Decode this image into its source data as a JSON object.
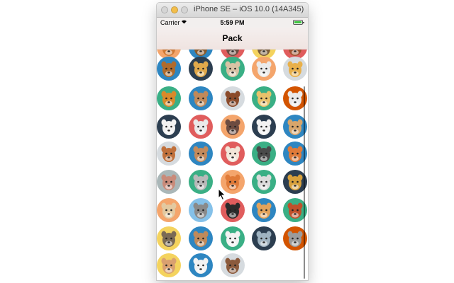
{
  "window": {
    "title": "iPhone SE – iOS 10.0 (14A345)"
  },
  "status_bar": {
    "carrier": "Carrier",
    "time": "5:59 PM"
  },
  "nav": {
    "title": "Pack"
  },
  "colors": {
    "nav_background": "#f2e8e6",
    "scroll_indicator": "#6f6f6f"
  },
  "animals": [
    {
      "name": "partial-top-1",
      "bg": "#f4a56c",
      "face": "#d17a35",
      "row": 0,
      "col": 0
    },
    {
      "name": "partial-top-2",
      "bg": "#2e86c1",
      "face": "#8a5a2b",
      "row": 0,
      "col": 1
    },
    {
      "name": "partial-top-3",
      "bg": "#e05d5d",
      "face": "#6d4c41",
      "row": 0,
      "col": 2
    },
    {
      "name": "partial-top-4",
      "bg": "#f4d35e",
      "face": "#7b5e3b",
      "row": 0,
      "col": 3
    },
    {
      "name": "partial-top-5",
      "bg": "#e05d5d",
      "face": "#a0522d",
      "row": 0,
      "col": 4
    },
    {
      "name": "deer",
      "bg": "#2e86c1",
      "face": "#b06b2c",
      "row": 1,
      "col": 0
    },
    {
      "name": "cheetah",
      "bg": "#2c3e50",
      "face": "#e1a94b",
      "row": 1,
      "col": 1
    },
    {
      "name": "goat",
      "bg": "#3aaf85",
      "face": "#d8c3a5",
      "row": 1,
      "col": 2
    },
    {
      "name": "zebra",
      "bg": "#f4a56c",
      "face": "#eaeaea",
      "row": 1,
      "col": 3
    },
    {
      "name": "giraffe",
      "bg": "#d6dbdf",
      "face": "#e8b04b",
      "row": 1,
      "col": 4
    },
    {
      "name": "lion",
      "bg": "#3aaf85",
      "face": "#d98a2b",
      "row": 2,
      "col": 0
    },
    {
      "name": "bull",
      "bg": "#2e86c1",
      "face": "#c0895a",
      "row": 2,
      "col": 1
    },
    {
      "name": "horse",
      "bg": "#d6dbdf",
      "face": "#8b4b2b",
      "row": 2,
      "col": 2
    },
    {
      "name": "jaguar",
      "bg": "#3aaf85",
      "face": "#e8c26b",
      "row": 2,
      "col": 3
    },
    {
      "name": "ibex",
      "bg": "#d35400",
      "face": "#eaeaea",
      "row": 2,
      "col": 4
    },
    {
      "name": "polar-bear",
      "bg": "#2c3e50",
      "face": "#f2f2f2",
      "row": 3,
      "col": 0
    },
    {
      "name": "antelope",
      "bg": "#e05d5d",
      "face": "#eaeaea",
      "row": 3,
      "col": 1
    },
    {
      "name": "bear",
      "bg": "#f4a56c",
      "face": "#6d4c41",
      "row": 3,
      "col": 2
    },
    {
      "name": "dog",
      "bg": "#2c3e50",
      "face": "#f2f2f2",
      "row": 3,
      "col": 3
    },
    {
      "name": "lynx",
      "bg": "#2e86c1",
      "face": "#d7a56b",
      "row": 3,
      "col": 4
    },
    {
      "name": "monkey",
      "bg": "#d6dbdf",
      "face": "#c0703b",
      "row": 4,
      "col": 0
    },
    {
      "name": "kangaroo",
      "bg": "#2e86c1",
      "face": "#c48a5b",
      "row": 4,
      "col": 1
    },
    {
      "name": "spaniel",
      "bg": "#e05d5d",
      "face": "#f2e6d9",
      "row": 4,
      "col": 2
    },
    {
      "name": "ram",
      "bg": "#3aaf85",
      "face": "#4a4a4a",
      "row": 4,
      "col": 3
    },
    {
      "name": "fox",
      "bg": "#2e86c1",
      "face": "#e07b39",
      "row": 4,
      "col": 4
    },
    {
      "name": "hippo",
      "bg": "#aab7b8",
      "face": "#c98b7a",
      "row": 5,
      "col": 0
    },
    {
      "name": "koala",
      "bg": "#3aaf85",
      "face": "#b9b9b9",
      "row": 5,
      "col": 1
    },
    {
      "name": "orangutan",
      "bg": "#f4a56c",
      "face": "#e07b39",
      "row": 5,
      "col": 2
    },
    {
      "name": "lemur",
      "bg": "#3aaf85",
      "face": "#dcdcdc",
      "row": 5,
      "col": 3
    },
    {
      "name": "lion-cub",
      "bg": "#2c3e50",
      "face": "#d9a13b",
      "row": 5,
      "col": 4
    },
    {
      "name": "pug",
      "bg": "#f4a56c",
      "face": "#e3c9a0",
      "row": 6,
      "col": 0
    },
    {
      "name": "wolf",
      "bg": "#85c1e9",
      "face": "#8a8a8a",
      "row": 6,
      "col": 1
    },
    {
      "name": "penguin",
      "bg": "#e05d5d",
      "face": "#2b2b2b",
      "row": 6,
      "col": 2
    },
    {
      "name": "retriever",
      "bg": "#2e86c1",
      "face": "#e3a35b",
      "row": 6,
      "col": 3
    },
    {
      "name": "red-panda",
      "bg": "#3aaf85",
      "face": "#c0502b",
      "row": 6,
      "col": 4
    },
    {
      "name": "hyena",
      "bg": "#f4d35e",
      "face": "#7a6a55",
      "row": 7,
      "col": 0
    },
    {
      "name": "coyote",
      "bg": "#2e86c1",
      "face": "#c08a5b",
      "row": 7,
      "col": 1
    },
    {
      "name": "cow",
      "bg": "#3aaf85",
      "face": "#f2f2f2",
      "row": 7,
      "col": 2
    },
    {
      "name": "shark",
      "bg": "#2c3e50",
      "face": "#9fb3c1",
      "row": 7,
      "col": 3
    },
    {
      "name": "raccoon",
      "bg": "#d35400",
      "face": "#9b9b9b",
      "row": 7,
      "col": 4
    },
    {
      "name": "hamster",
      "bg": "#f4d35e",
      "face": "#d9a070",
      "row": 8,
      "col": 0
    },
    {
      "name": "calf",
      "bg": "#2e86c1",
      "face": "#f2f2f2",
      "row": 8,
      "col": 1
    },
    {
      "name": "otter",
      "bg": "#d6dbdf",
      "face": "#8b5a3c",
      "row": 8,
      "col": 2
    }
  ]
}
